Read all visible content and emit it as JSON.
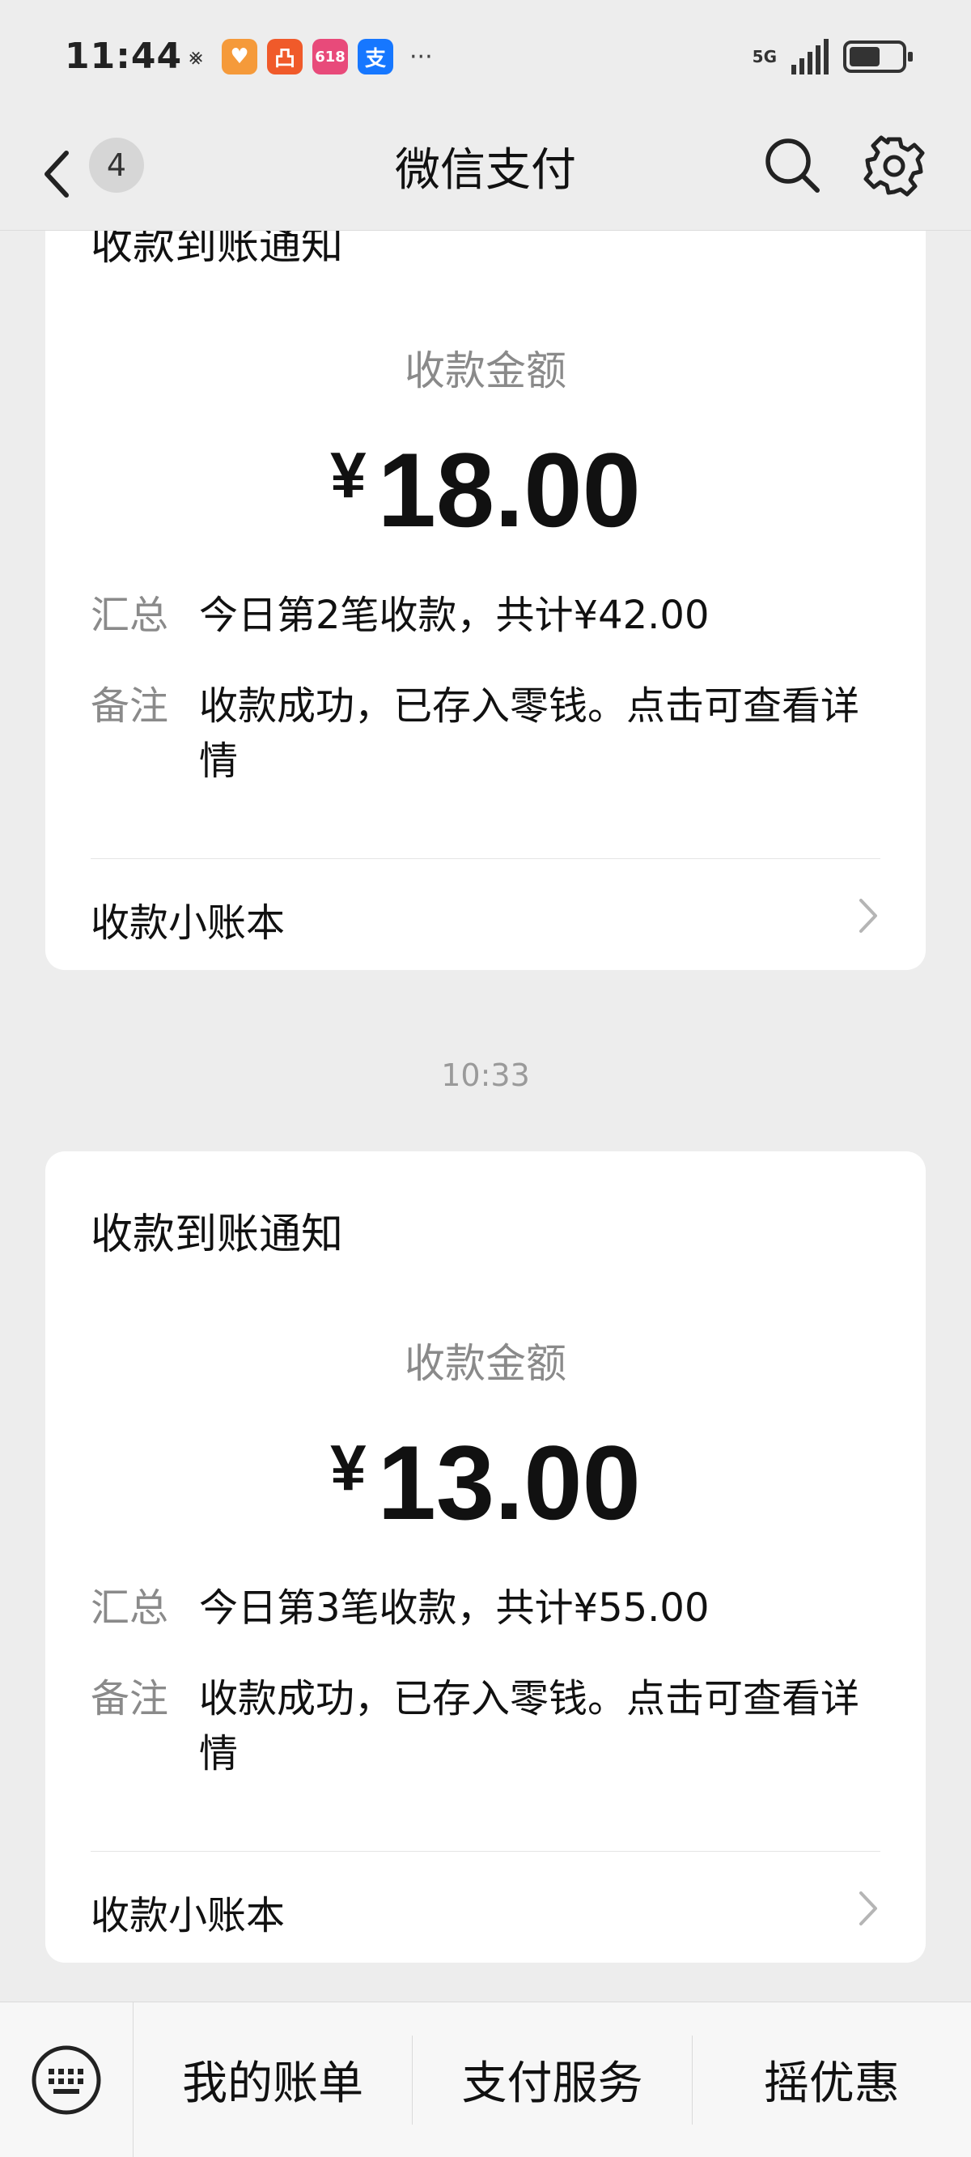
{
  "status_bar": {
    "time": "11:44",
    "net": "5G",
    "apps": [
      {
        "icon": "muted-call-icon",
        "glyph": "⨳",
        "color": "#333333"
      },
      {
        "icon": "heart-app-icon",
        "glyph": "♥",
        "color": "#f59a3a"
      },
      {
        "icon": "orange-app-icon",
        "glyph": "凸",
        "color": "#f05a2a"
      },
      {
        "icon": "618-app-icon",
        "glyph": "618",
        "color": "#e84a7a"
      },
      {
        "icon": "alipay-icon",
        "glyph": "支",
        "color": "#1677ff"
      }
    ],
    "more": "···"
  },
  "header": {
    "unread_count": "4",
    "title": "微信支付"
  },
  "messages": [
    {
      "title": "收款到账通知",
      "amount_label": "收款金额",
      "currency": "¥",
      "amount": "18.00",
      "summary_key": "汇总",
      "summary_value": "今日第2笔收款，共计¥42.00",
      "note_key": "备注",
      "note_value": "收款成功，已存入零钱。点击可查看详情",
      "link": "收款小账本"
    },
    {
      "timestamp": "10:33",
      "title": "收款到账通知",
      "amount_label": "收款金额",
      "currency": "¥",
      "amount": "13.00",
      "summary_key": "汇总",
      "summary_value": "今日第3笔收款，共计¥55.00",
      "note_key": "备注",
      "note_value": "收款成功，已存入零钱。点击可查看详情",
      "link": "收款小账本"
    }
  ],
  "bottom_menu": {
    "items": [
      "我的账单",
      "支付服务",
      "摇优惠"
    ]
  },
  "colors": {
    "background": "#ededed",
    "card": "#ffffff",
    "secondary_text": "#8a8a8a"
  }
}
